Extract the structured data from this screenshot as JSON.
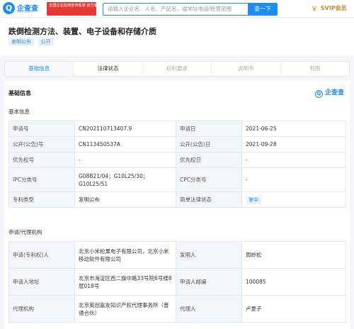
{
  "header": {
    "logo_text": "企查查",
    "logo_sub": "Qcc.com",
    "badge_text": "全国企业信用查询系统 官方备案企业征信机构",
    "search_placeholder": "请输入企业名、人名、产品名，或地址电话/经营范围",
    "search_button": "查一下",
    "vip_label": "SVIP会员"
  },
  "page": {
    "title": "跌倒检测方法、装置、电子设备和存储介质",
    "tags": [
      "发明公布",
      "公开"
    ]
  },
  "tabs": [
    "基础信息",
    "法律状态",
    "权利要求",
    "说明书",
    "附图"
  ],
  "main": {
    "section_title": "基础信息",
    "brand_label": "企查查",
    "basic_title": "基本信息",
    "basic_rows": [
      {
        "k1": "申请号",
        "v1": "CN202110713407.9",
        "k2": "申请日",
        "v2": "2021-06-25"
      },
      {
        "k1": "公开(公告)号",
        "v1": "CN113450537A",
        "k2": "公开(公告)日",
        "v2": "2021-09-28"
      },
      {
        "k1": "优先权号",
        "v1": "-",
        "k2": "优先权日",
        "v2": "-"
      },
      {
        "k1": "IPC分类号",
        "v1": "G08B21/04；G10L25/30；G10L25/51",
        "k2": "CPC分类号",
        "v2": "-"
      },
      {
        "k1": "专利类型",
        "v1": "发明公布",
        "k2": "简单法律状态",
        "v2": "审中"
      }
    ],
    "agency_title": "申请/代理机构",
    "agency_rows": [
      {
        "k1": "申请(专利权)人",
        "v1": "北京小米松果电子有限公司，北京小米移动软件有限公司",
        "k2": "发明人",
        "v2": "周岭松"
      },
      {
        "k1": "申请人地址",
        "v1": "北京市海淀区西二旗中路33号院6号楼8层018号",
        "k2": "申请人邮编",
        "v2": "100085"
      },
      {
        "k1": "代理机构",
        "v1": "北京英创嘉友知识产权代理事务所（普通合伙）",
        "k2": "代理人",
        "v2": "卢夏子"
      }
    ]
  },
  "colors": {
    "accent": "#1e8cf0",
    "badge": "#e53935",
    "vip": "#c78a2e"
  }
}
